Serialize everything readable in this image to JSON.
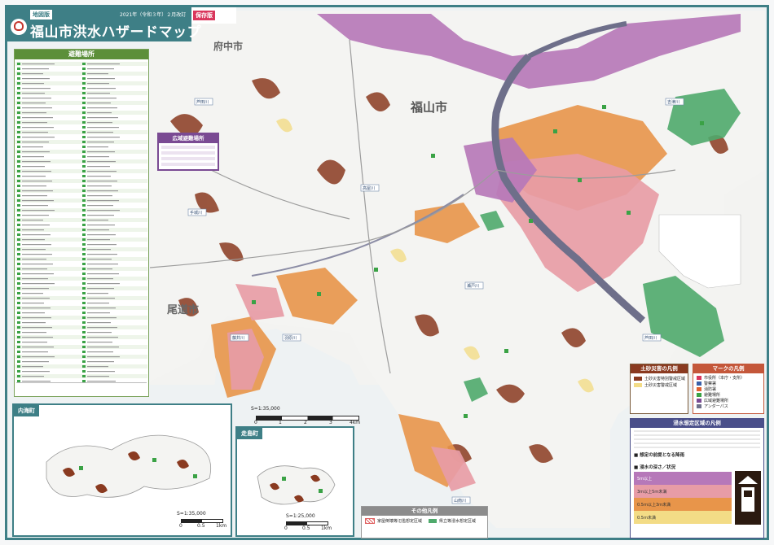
{
  "title": {
    "edition_badge": "地図版",
    "main": "福山市洪水ハザードマップ",
    "date": "2021年（令和３年）２月改訂",
    "save_badge": "保存版"
  },
  "place_names": {
    "fukuyama": "福山市",
    "fuchu": "府中市",
    "onomichi": "尾道市"
  },
  "evacuation_list": {
    "heading": "避難場所"
  },
  "wide_area_box": {
    "heading": "広域避難場所"
  },
  "rivers": [
    "芦田川",
    "高屋川",
    "手城川",
    "瀬戸川",
    "藤井川",
    "羽原川",
    "芦田川",
    "吉津川",
    "山南川"
  ],
  "insets": {
    "utsumi": {
      "label": "内海町",
      "scale": "S=1:35,000",
      "ticks": [
        "0",
        "0.5",
        "1km"
      ]
    },
    "hashiri": {
      "label": "走島町",
      "scale": "S=1:25,000",
      "ticks": [
        "0",
        "0.5",
        "1km"
      ]
    }
  },
  "main_scale": {
    "label": "S=1:35,000",
    "ticks": [
      "0",
      "1",
      "2",
      "3",
      "4km"
    ]
  },
  "legends": {
    "sediment": {
      "heading": "土砂災害の凡例",
      "rows": [
        "土砂災害特別警戒区域",
        "土砂災害警戒区域"
      ]
    },
    "marks": {
      "heading": "マークの凡例",
      "rows": [
        "市役所（本庁・支所）",
        "警察署",
        "消防署",
        "避難場所",
        "広域避難場所",
        "アンダーパス"
      ]
    },
    "inundation": {
      "heading": "浸水想定区域の凡例",
      "depths": [
        "5ｍ以上",
        "3ｍ以上5ｍ未満",
        "0.5ｍ以上3ｍ未満",
        "0.5ｍ未満"
      ],
      "note_title": "■ 想定の前提となる降雨",
      "depth_title": "■ 浸水の深さ／状況"
    },
    "other": {
      "heading": "その他凡例",
      "rows": [
        "家屋倒壊等氾濫想定区域",
        "県立等浸水想定区域"
      ]
    }
  },
  "colors": {
    "frame": "#3e7f86",
    "flood_pink": "#e79ca6",
    "flood_orange": "#e8954a",
    "flood_purple": "#b678b9",
    "river": "#6e6f8a",
    "sediment_brown": "#8a3a20",
    "sediment_yellow": "#f3dc86",
    "green_zone": "#4faa6c",
    "sea": "#eef2f3"
  }
}
